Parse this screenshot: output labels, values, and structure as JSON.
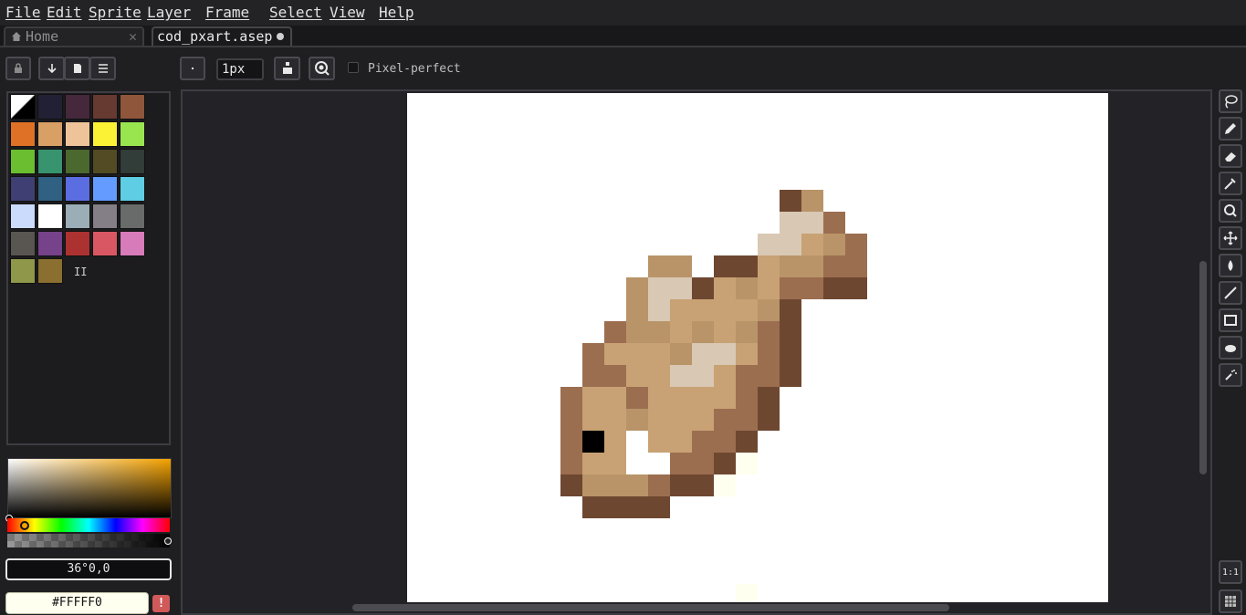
{
  "menu": [
    "File",
    "Edit",
    "Sprite",
    "Layer",
    "Frame",
    "Select",
    "View",
    "Help"
  ],
  "tabs": {
    "home": "Home",
    "active": "cod_pxart.asep"
  },
  "toolbar": {
    "brush_size": "1px",
    "pixel_perfect": "Pixel-perfect"
  },
  "color": {
    "hsv": "36°0,0",
    "hex": "#FFFFF0",
    "warn": "!"
  },
  "palette": [
    "#000000",
    "#222034",
    "#45283c",
    "#663931",
    "#8f563b",
    "#df7126",
    "#d9a066",
    "#eec39a",
    "#fbf236",
    "#99e550",
    "#6abe30",
    "#37946e",
    "#4b692f",
    "#524b24",
    "#323c39",
    "#3f3f74",
    "#306082",
    "#5b6ee1",
    "#639bff",
    "#5fcde4",
    "#cbdbfc",
    "#ffffff",
    "#9badb7",
    "#847e87",
    "#696a6a",
    "#595652",
    "#76428a",
    "#ac3232",
    "#d95763",
    "#d77bba",
    "#8f974a",
    "#8a6f30"
  ],
  "palette_count_label": "II",
  "tools_right": [
    "lasso-icon",
    "pencil-icon",
    "eraser-icon",
    "eyedropper-icon",
    "zoom-icon",
    "move-icon",
    "fill-icon",
    "line-icon",
    "rectangle-icon",
    "ellipse-icon",
    "spray-icon"
  ],
  "zoom_button": "1:1"
}
